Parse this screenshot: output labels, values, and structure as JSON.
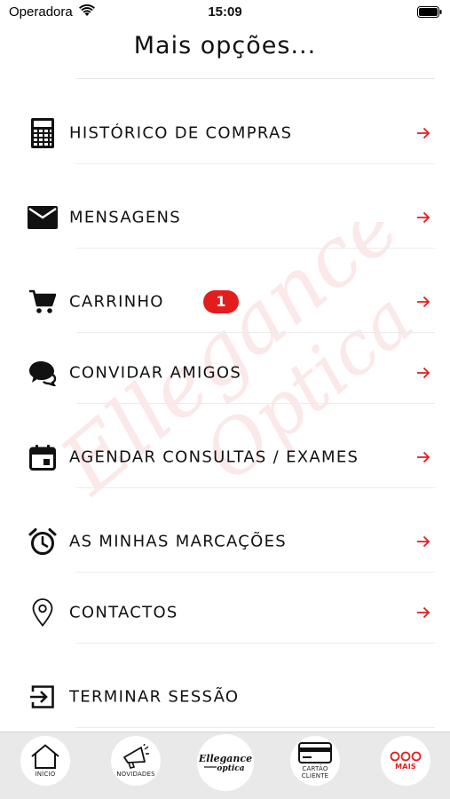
{
  "status_bar": {
    "carrier": "Operadora",
    "time": "15:09"
  },
  "page": {
    "title": "Mais opções..."
  },
  "watermark": {
    "text_line1": "Ellegance",
    "text_line2": "Optica"
  },
  "menu": [
    {
      "label": "HISTÓRICO DE COMPRAS",
      "icon": "calculator-icon"
    },
    {
      "label": "MENSAGENS",
      "icon": "envelope-icon"
    },
    {
      "label": "CARRINHO",
      "icon": "cart-icon",
      "badge": "1"
    },
    {
      "label": "CONVIDAR AMIGOS",
      "icon": "chat-bubbles-icon"
    },
    {
      "label": "AGENDAR CONSULTAS / EXAMES",
      "icon": "calendar-icon"
    },
    {
      "label": "AS MINHAS MARCAÇÕES",
      "icon": "alarm-clock-icon"
    },
    {
      "label": "CONTACTOS",
      "icon": "location-pin-icon"
    },
    {
      "label": "TERMINAR SESSÃO",
      "icon": "logout-icon"
    }
  ],
  "colors": {
    "accent": "#e31d1d",
    "tab_bar_bg": "#e9e9e9",
    "text": "#111111"
  },
  "tab_bar": {
    "tabs": [
      {
        "label": "INÍCIO",
        "icon": "home-icon"
      },
      {
        "label": "NOVIDADES",
        "icon": "megaphone-icon"
      },
      {
        "label": "",
        "icon": "brand-logo",
        "logo_text": "Ellegance",
        "logo_sub": "optica"
      },
      {
        "label": "CARTÃO CLIENTE",
        "icon": "credit-card-icon"
      },
      {
        "label": "MAIS",
        "icon": "more-dots-icon"
      }
    ]
  }
}
